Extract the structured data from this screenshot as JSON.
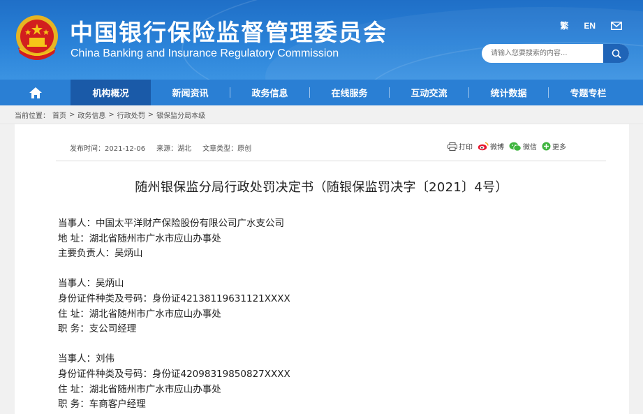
{
  "header": {
    "title_cn": "中国银行保险监督管理委员会",
    "title_en": "China Banking and Insurance Regulatory Commission",
    "links": {
      "fan": "繁",
      "en": "EN"
    },
    "search_placeholder": "请输入您要搜索的内容..."
  },
  "nav": {
    "items": [
      "机构概况",
      "新闻资讯",
      "政务信息",
      "在线服务",
      "互动交流",
      "统计数据",
      "专题专栏"
    ],
    "active": "机构概况"
  },
  "breadcrumb": {
    "label": "当前位置：",
    "items": [
      "首页",
      "政务信息",
      "行政处罚",
      "银保监分局本级"
    ],
    "separator": ">"
  },
  "meta": {
    "publish_label": "发布时间：",
    "publish_date": "2021-12-06",
    "source_label": "来源：",
    "source": "湖北",
    "type_label": "文章类型：",
    "type": "原创"
  },
  "share": {
    "print": "打印",
    "weibo": "微博",
    "wechat": "微信",
    "more": "更多"
  },
  "document": {
    "title": "随州银保监分局行政处罚决定书（随银保监罚决字〔2021〕4号）",
    "paragraphs": [
      [
        "当事人：中国太平洋财产保险股份有限公司广水支公司",
        "地  址：湖北省随州市广水市应山办事处",
        "主要负责人：吴炳山"
      ],
      [
        "当事人：吴炳山",
        "身份证件种类及号码：身份证42138119631121XXXX",
        "住  址：湖北省随州市广水市应山办事处",
        "职  务：支公司经理"
      ],
      [
        "当事人：刘伟",
        "身份证件种类及号码：身份证42098319850827XXXX",
        "住  址：湖北省随州市广水市应山办事处",
        "职  务：车商客户经理"
      ]
    ]
  },
  "colors": {
    "header": "#2a82d8",
    "nav": "#2a7fd4",
    "nav_active": "#1a5aa8",
    "search_button": "#1f64b7"
  }
}
